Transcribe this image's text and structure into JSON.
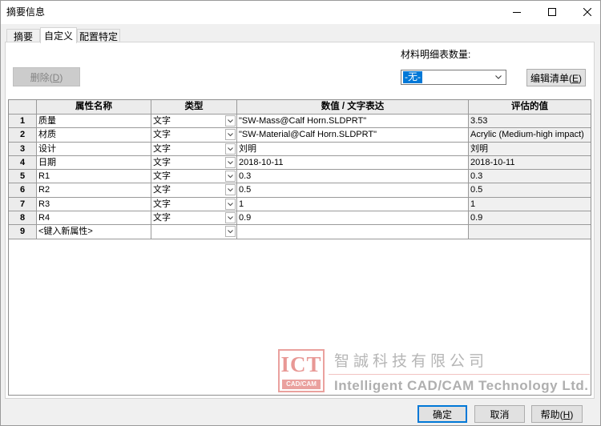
{
  "window": {
    "title": "摘要信息",
    "controls": [
      "minimize-icon",
      "maximize-icon",
      "close-icon"
    ]
  },
  "tabs": [
    {
      "label": "摘要",
      "selected": false
    },
    {
      "label": "自定义",
      "selected": true
    },
    {
      "label": "配置特定",
      "selected": false
    }
  ],
  "toolbar": {
    "delete": {
      "label": "删除(D)",
      "enabled": false
    },
    "bom_quantity": {
      "label": "材料明细表数量:",
      "value": "-无-",
      "icon": "chevron-down-icon"
    },
    "edit_list": {
      "label": "编辑清单(E)"
    }
  },
  "grid": {
    "columns": {
      "name": "属性名称",
      "type": "类型",
      "value": "数值 / 文字表达",
      "evaluated": "评估的值"
    },
    "type_dropdown_icon": "chevron-down-icon",
    "rows": [
      {
        "index": "1",
        "name": "质量",
        "type": "文字",
        "value": "\"SW-Mass@Calf Horn.SLDPRT\"",
        "evaluated": "3.53"
      },
      {
        "index": "2",
        "name": "材质",
        "type": "文字",
        "value": "\"SW-Material@Calf Horn.SLDPRT\"",
        "evaluated": "Acrylic (Medium-high impact)"
      },
      {
        "index": "3",
        "name": "设计",
        "type": "文字",
        "value": "刘明",
        "evaluated": "刘明"
      },
      {
        "index": "4",
        "name": "日期",
        "type": "文字",
        "value": "2018-10-11",
        "evaluated": "2018-10-11"
      },
      {
        "index": "5",
        "name": "R1",
        "type": "文字",
        "value": "0.3",
        "evaluated": "0.3"
      },
      {
        "index": "6",
        "name": "R2",
        "type": "文字",
        "value": "0.5",
        "evaluated": "0.5"
      },
      {
        "index": "7",
        "name": "R3",
        "type": "文字",
        "value": "1",
        "evaluated": "1"
      },
      {
        "index": "8",
        "name": "R4",
        "type": "文字",
        "value": "0.9",
        "evaluated": "0.9"
      },
      {
        "index": "9",
        "name": "<键入新属性>",
        "type": "",
        "value": "",
        "evaluated": ""
      }
    ]
  },
  "footer": {
    "ok": "确定",
    "cancel": "取消",
    "help": "帮助(H)"
  },
  "watermark": {
    "logo_text": "ICT",
    "logo_subtext": "CAD/CAM",
    "company_name_zh": "智誠科技有限公司",
    "company_name_en": "Intelligent CAD/CAM Technology Ltd."
  },
  "colors": {
    "accent": "#0078d7",
    "selection_highlight": "#0078d7",
    "dialog_background": "#f0f0f0",
    "disabled_text": "#838383",
    "watermark_red": "#d9534f"
  }
}
